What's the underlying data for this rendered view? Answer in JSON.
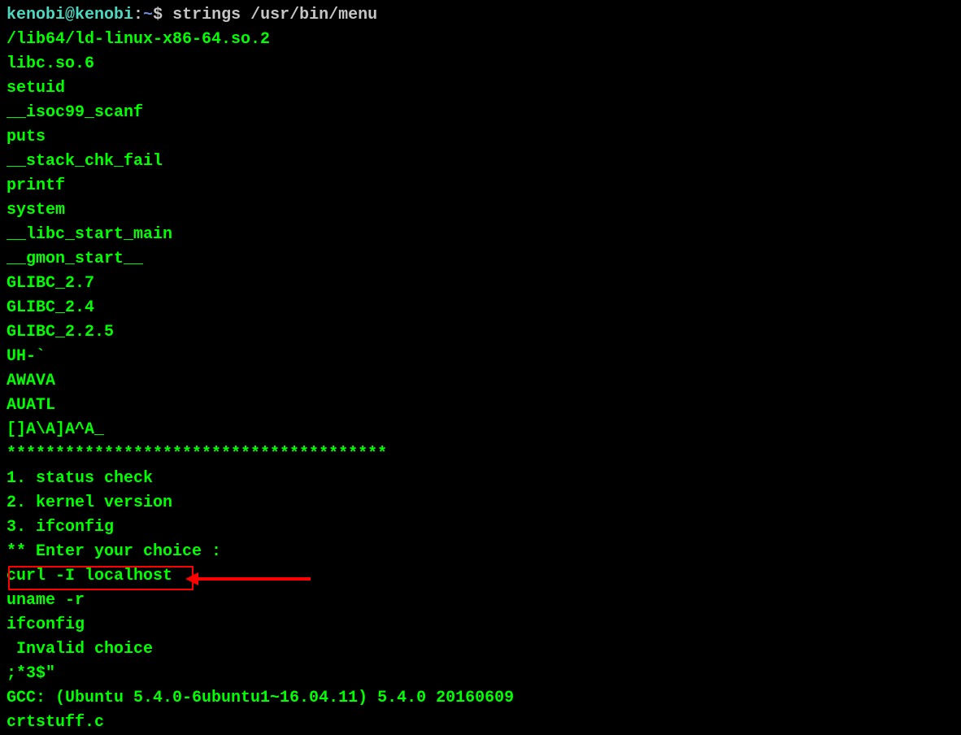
{
  "prompt": {
    "userHost": "kenobi@kenobi",
    "colon": ":",
    "path": "~",
    "dollar": "$ ",
    "command": "strings /usr/bin/menu"
  },
  "output": [
    "/lib64/ld-linux-x86-64.so.2",
    "libc.so.6",
    "setuid",
    "__isoc99_scanf",
    "puts",
    "__stack_chk_fail",
    "printf",
    "system",
    "__libc_start_main",
    "__gmon_start__",
    "GLIBC_2.7",
    "GLIBC_2.4",
    "GLIBC_2.2.5",
    "UH-`",
    "AWAVA",
    "AUATL",
    "[]A\\A]A^A_",
    "***************************************",
    "1. status check",
    "2. kernel version",
    "3. ifconfig",
    "** Enter your choice :",
    "curl -I localhost",
    "uname -r",
    "ifconfig",
    " Invalid choice",
    ";*3$\"",
    "GCC: (Ubuntu 5.4.0-6ubuntu1~16.04.11) 5.4.0 20160609",
    "crtstuff.c"
  ],
  "annotation": {
    "highlightedLine": "curl -I localhost"
  }
}
